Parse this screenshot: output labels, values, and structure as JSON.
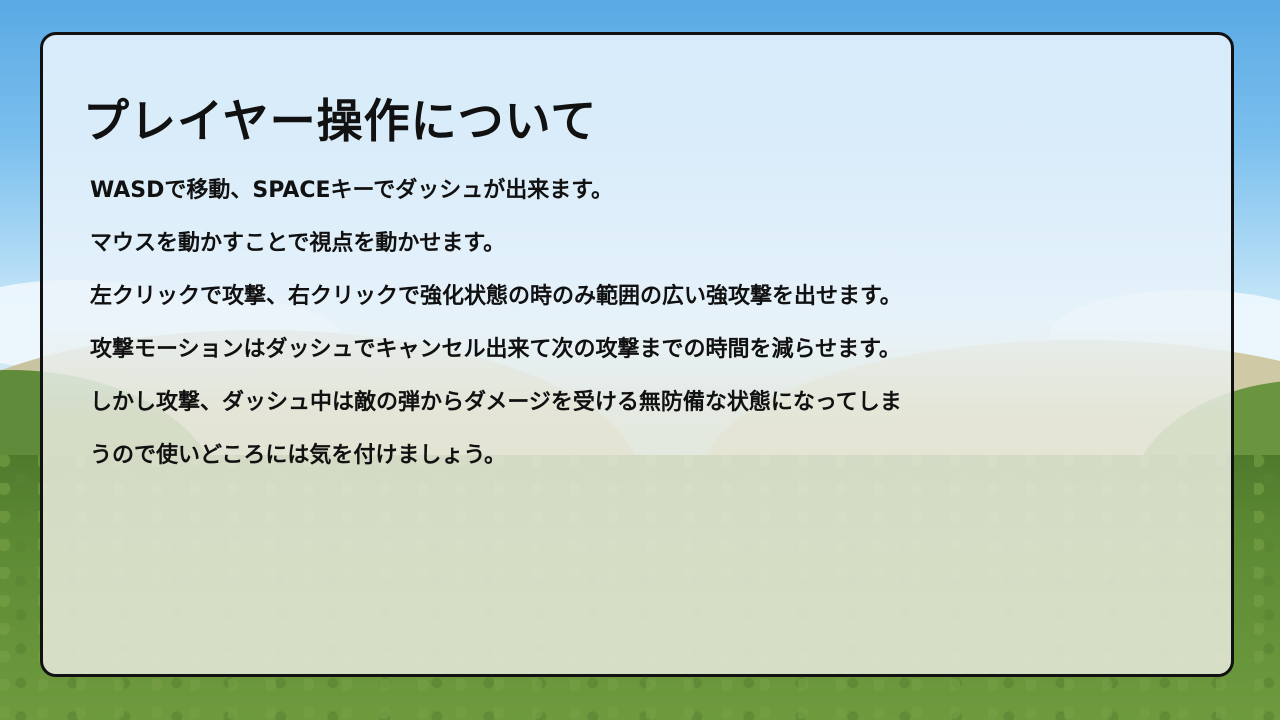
{
  "panel": {
    "title": "プレイヤー操作について",
    "lines": [
      "WASDで移動、SPACEキーでダッシュが出来ます。",
      "マウスを動かすことで視点を動かせます。",
      "左クリックで攻撃、右クリックで強化状態の時のみ範囲の広い強攻撃を出せます。",
      "攻撃モーションはダッシュでキャンセル出来て次の攻撃までの時間を減らせます。",
      "しかし攻撃、ダッシュ中は敵の弾からダメージを受ける無防備な状態になってしま",
      "うので使いどころには気を付けましょう。"
    ]
  },
  "colors": {
    "panel_border": "#111111",
    "sky": "#5aa9e4",
    "grass": "#5c8a34"
  }
}
